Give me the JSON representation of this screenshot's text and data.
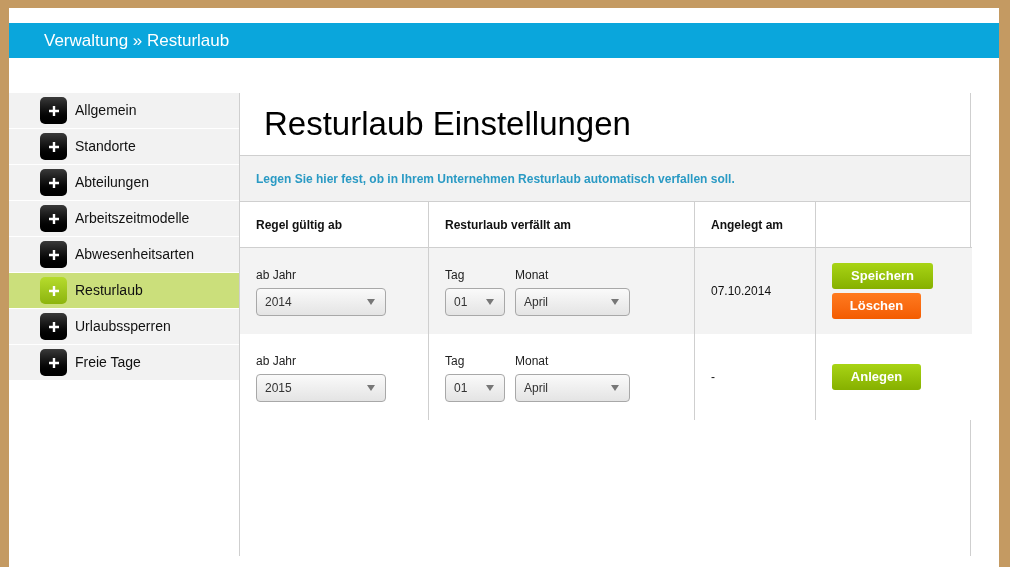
{
  "header": {
    "breadcrumb": "Verwaltung » Resturlaub"
  },
  "sidebar": {
    "items": [
      {
        "label": "Allgemein",
        "selected": false
      },
      {
        "label": "Standorte",
        "selected": false
      },
      {
        "label": "Abteilungen",
        "selected": false
      },
      {
        "label": "Arbeitszeitmodelle",
        "selected": false
      },
      {
        "label": "Abwesenheitsarten",
        "selected": false
      },
      {
        "label": "Resturlaub",
        "selected": true
      },
      {
        "label": "Urlaubssperren",
        "selected": false
      },
      {
        "label": "Freie Tage",
        "selected": false
      }
    ]
  },
  "page": {
    "title": "Resturlaub Einstellungen",
    "description": "Legen Sie hier fest, ob in Ihrem Unternehmen Resturlaub automatisch verfallen soll."
  },
  "table": {
    "columns": [
      "Regel gültig ab",
      "Resturlaub verfällt am",
      "Angelegt am"
    ],
    "rows": [
      {
        "kind": "existing",
        "year_label": "ab Jahr",
        "year": "2014",
        "day_label": "Tag",
        "day": "01",
        "month_label": "Monat",
        "month": "April",
        "created": "07.10.2014",
        "buttons": [
          {
            "kind": "save",
            "label": "Speichern"
          },
          {
            "kind": "delete",
            "label": "Löschen"
          }
        ]
      },
      {
        "kind": "new",
        "year_label": "ab Jahr",
        "year": "2015",
        "day_label": "Tag",
        "day": "01",
        "month_label": "Monat",
        "month": "April",
        "created": "-",
        "buttons": [
          {
            "kind": "create",
            "label": "Anlegen"
          }
        ]
      }
    ]
  }
}
